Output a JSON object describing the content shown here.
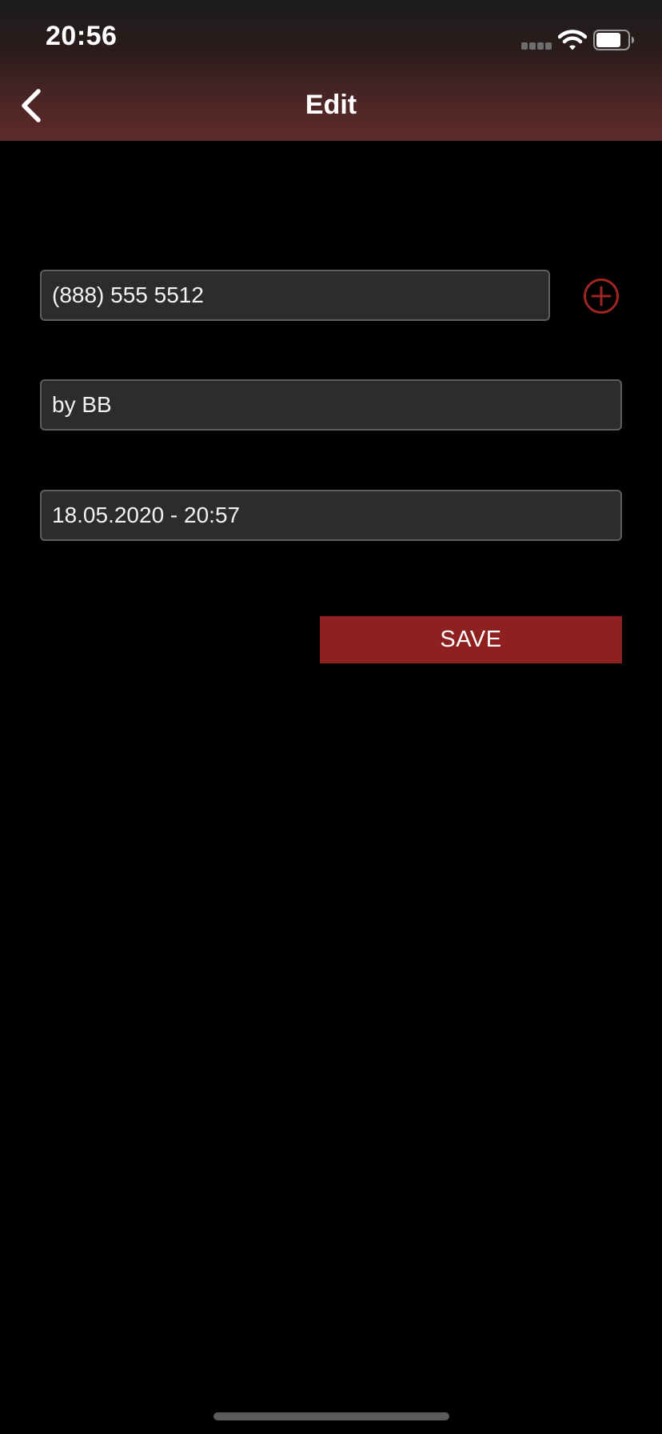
{
  "status_bar": {
    "time": "20:56",
    "icons": [
      "signal-icon",
      "wifi-icon",
      "battery-icon"
    ]
  },
  "nav": {
    "title": "Edit",
    "back_icon": "chevron-left-icon"
  },
  "form": {
    "phone": "(888) 555 5512",
    "note": "by BB",
    "datetime": "18.05.2020 - 20:57",
    "add_icon": "plus-circle-icon",
    "save_label": "SAVE"
  },
  "colors": {
    "accent": "#8e201f",
    "add_icon": "#a02420",
    "field_bg": "#2c2c2e",
    "field_border": "#5e5e5e",
    "header_bottom": "#5e2b2b",
    "background": "#000000"
  }
}
